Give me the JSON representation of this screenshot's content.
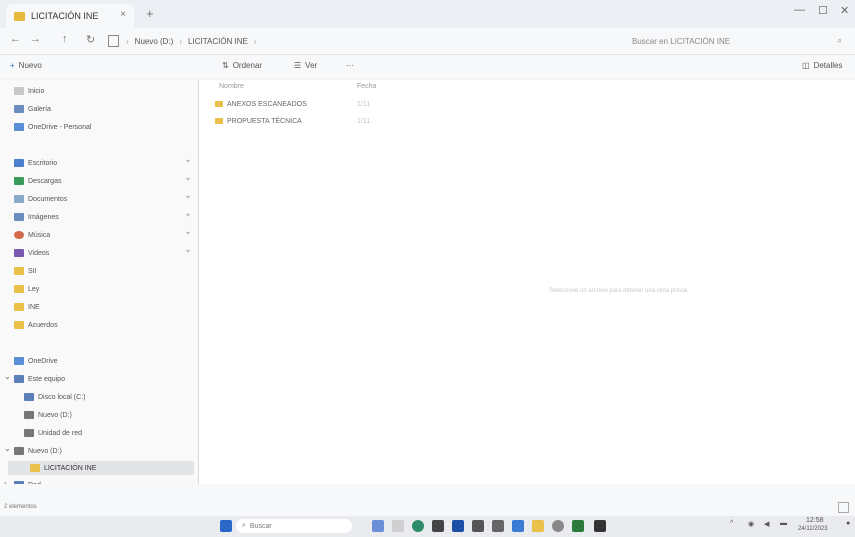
{
  "window": {
    "tab_title": "LICITACIÓN INE",
    "tab_close": "×",
    "new_tab": "+",
    "controls": {
      "minimize": "—",
      "maximize": "☐",
      "close": "✕"
    }
  },
  "address_bar": {
    "back": "←",
    "forward": "→",
    "up": "↑",
    "refresh": "↻",
    "breadcrumbs": [
      "Nuevo (D:)",
      "LICITACIÓN INE"
    ],
    "search_placeholder": "Buscar en LICITACIÓN INE"
  },
  "command_bar": {
    "new_label": "Nuevo",
    "sort_label": "Ordenar",
    "view_label": "Ver",
    "more": "···",
    "details_label": "Detalles"
  },
  "sidebar": {
    "items": [
      {
        "label": "Inicio"
      },
      {
        "label": "Galería"
      },
      {
        "label": "OneDrive - Personal"
      },
      {
        "label": "Escritorio",
        "pinned": true
      },
      {
        "label": "Descargas",
        "pinned": true
      },
      {
        "label": "Documentos",
        "pinned": true
      },
      {
        "label": "Imágenes",
        "pinned": true
      },
      {
        "label": "Música",
        "pinned": true
      },
      {
        "label": "Videos",
        "pinned": true
      },
      {
        "label": "SII"
      },
      {
        "label": "Ley"
      },
      {
        "label": "INE"
      },
      {
        "label": "Acuerdos"
      },
      {
        "label": "OneDrive"
      },
      {
        "label": "Este equipo"
      },
      {
        "label": "Disco local (C:)"
      },
      {
        "label": "Nuevo (D:)"
      },
      {
        "label": "Unidad de red"
      },
      {
        "label": "Nuevo (D:)"
      },
      {
        "label": "LICITACIÓN INE"
      },
      {
        "label": "Red"
      },
      {
        "label": "Red"
      }
    ],
    "pin_glyph": "⌖",
    "expand_glyph": "›",
    "collapse_glyph": "⌄"
  },
  "file_list": {
    "columns": [
      "Nombre",
      "Fecha"
    ],
    "rows": [
      {
        "name": "ANEXOS ESCANEADOS",
        "date": "1/11"
      },
      {
        "name": "PROPUESTA TÉCNICA",
        "date": "1/11"
      }
    ],
    "preview_hint": "Seleccione un archivo para obtener una vista previa."
  },
  "status_bar": {
    "text": "2 elementos"
  },
  "taskbar": {
    "search_placeholder": "Buscar",
    "time": "12:58",
    "date": "24/11/2023"
  },
  "colors": {
    "accent": "#3b6fd1",
    "folder": "#e8c04a",
    "selection": "#e2e4e7"
  }
}
